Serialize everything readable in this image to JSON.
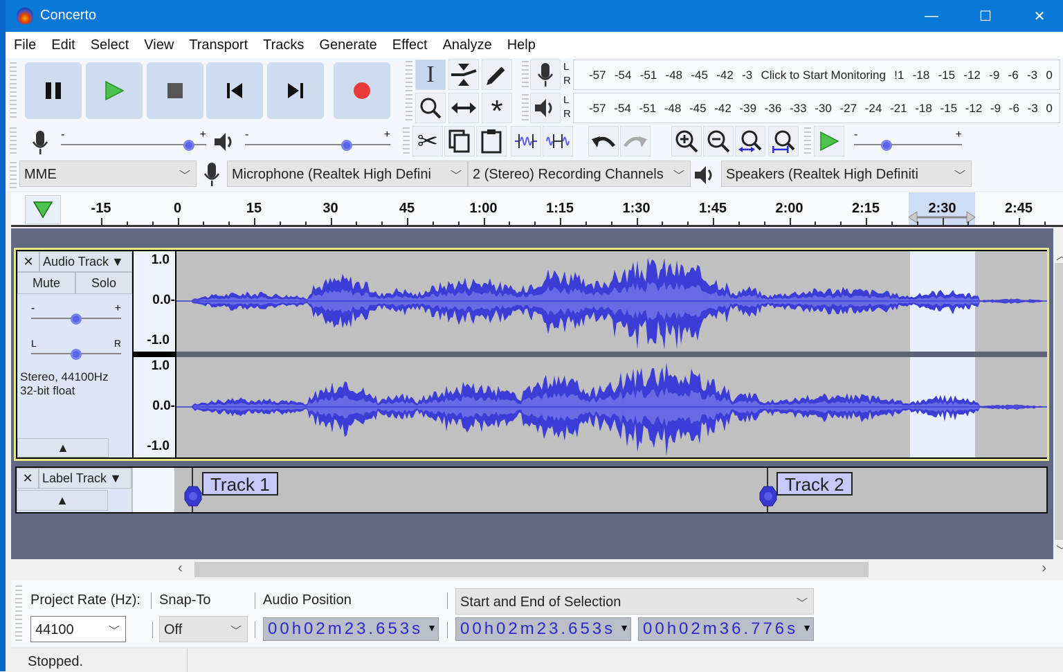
{
  "window": {
    "title": "Concerto",
    "controls": {
      "minimize": "—",
      "maximize": "☐",
      "close": "✕"
    }
  },
  "menu": [
    "File",
    "Edit",
    "Select",
    "View",
    "Transport",
    "Tracks",
    "Generate",
    "Effect",
    "Analyze",
    "Help"
  ],
  "transport": {
    "buttons": [
      "pause",
      "play",
      "stop",
      "skip-to-start",
      "skip-to-end",
      "record"
    ]
  },
  "tools": [
    "selection-tool",
    "envelope-tool",
    "draw-tool",
    "zoom-tool",
    "time-shift-tool",
    "multi-tool"
  ],
  "meters": {
    "record_scale": [
      "-57",
      "-54",
      "-51",
      "-48",
      "-45",
      "-42",
      "-3",
      "Click to Start Monitoring",
      "!1",
      "-18",
      "-15",
      "-12",
      "-9",
      "-6",
      "-3",
      "0"
    ],
    "playback_scale": [
      "-57",
      "-54",
      "-51",
      "-48",
      "-45",
      "-42",
      "-39",
      "-36",
      "-33",
      "-30",
      "-27",
      "-24",
      "-21",
      "-18",
      "-15",
      "-12",
      "-9",
      "-6",
      "-3",
      "0"
    ],
    "channel_l": "L",
    "channel_r": "R"
  },
  "mixer": {
    "minus": "-",
    "plus": "+",
    "record_volume": 0.88,
    "playback_volume": 0.7,
    "play_at_speed": 0.3
  },
  "devices": {
    "host": "MME",
    "input": "Microphone (Realtek High Defini",
    "channels": "2 (Stereo) Recording Channels",
    "output": "Speakers (Realtek High Definiti"
  },
  "timeline": {
    "labels": [
      "-15",
      "0",
      "15",
      "30",
      "45",
      "1:00",
      "1:15",
      "1:30",
      "1:45",
      "2:00",
      "2:15",
      "2:30",
      "2:45"
    ]
  },
  "audio_track": {
    "name": "Audio Track",
    "mute": "Mute",
    "solo": "Solo",
    "gain_minus": "-",
    "gain_plus": "+",
    "pan_l": "L",
    "pan_r": "R",
    "gain": 0.5,
    "pan": 0.5,
    "info_line1": "Stereo, 44100Hz",
    "info_line2": "32-bit float",
    "scale": [
      "1.0",
      "0.0-",
      "-1.0"
    ]
  },
  "label_track": {
    "name": "Label Track",
    "labels": [
      {
        "text": "Track 1"
      },
      {
        "text": "Track 2"
      }
    ]
  },
  "selection_bar": {
    "project_rate_label": "Project Rate (Hz):",
    "project_rate": "44100",
    "snap_to_label": "Snap-To",
    "snap_to": "Off",
    "audio_position_label": "Audio Position",
    "audio_position": "00h02m23.653s",
    "selection_mode": "Start and End of Selection",
    "selection_start": "00h02m23.653s",
    "selection_end": "00h02m36.776s"
  },
  "status": {
    "text": "Stopped."
  },
  "colors": {
    "titlebar": "#0a78d7",
    "waveform": "#3c3cd6",
    "waveform_rms": "#6a6ae6",
    "track_bg": "#c0c0c0",
    "selection": "#e8f0fc",
    "focus_border": "#f0f08c"
  }
}
